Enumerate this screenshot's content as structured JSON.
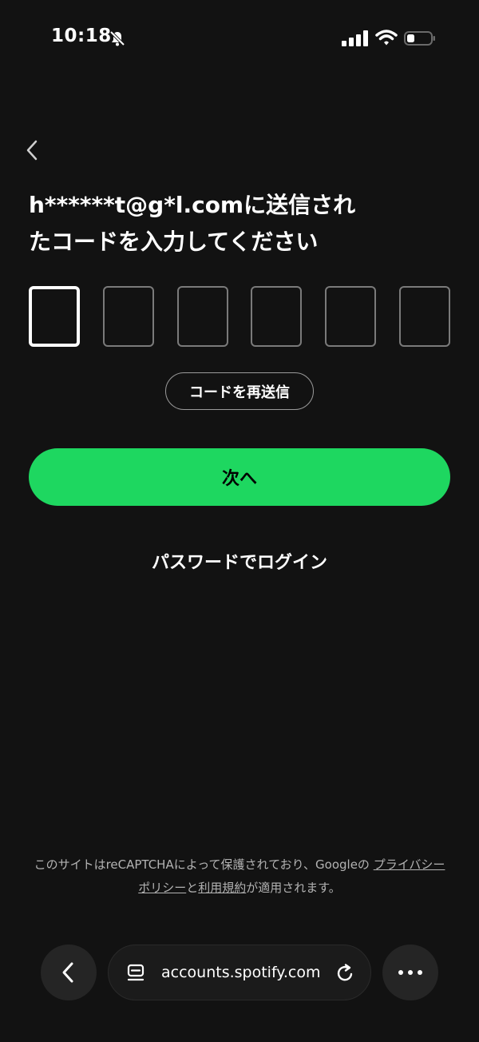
{
  "status_bar": {
    "time": "10:18"
  },
  "heading": {
    "line1": "h******t@g*l.comに送信され",
    "line2": "たコードを入力してください"
  },
  "code_inputs": {
    "count": 6,
    "active_index": 0
  },
  "resend_label": "コードを再送信",
  "next_label": "次へ",
  "password_login_label": "パスワードでログイン",
  "recaptcha": {
    "prefix": "このサイトはreCAPTCHAによって保護されており、Googleの ",
    "privacy_link": "プライバシーポリシー",
    "connector": "と",
    "terms_link": "利用規約",
    "suffix": "が適用されます。"
  },
  "browser": {
    "url": "accounts.spotify.com"
  },
  "colors": {
    "background": "#121212",
    "accent": "#1ed760",
    "muted_text": "#b3b3b3"
  },
  "icons": [
    "bell-slash-icon",
    "signal-icon",
    "wifi-icon",
    "battery-icon",
    "chevron-left-icon",
    "tab-icon",
    "reload-icon",
    "more-icon"
  ]
}
